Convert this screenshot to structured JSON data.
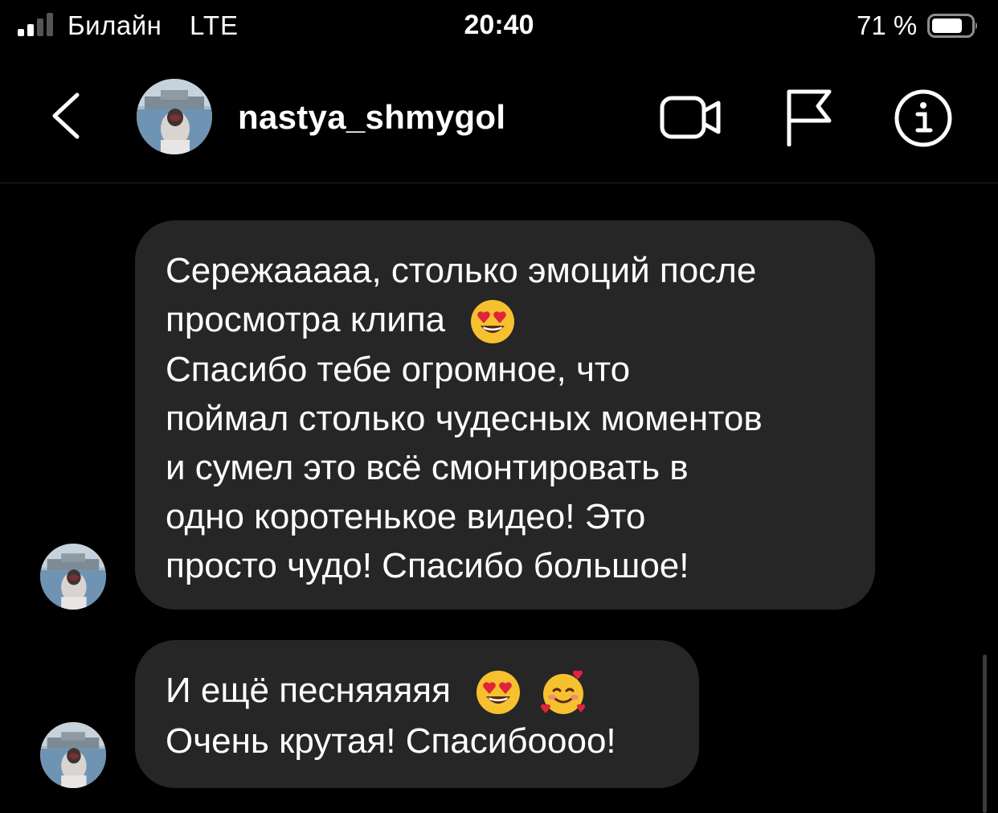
{
  "status_bar": {
    "carrier": "Билайн",
    "network": "LTE",
    "time": "20:40",
    "battery": "71 %"
  },
  "header": {
    "username": "nastya_shmygol",
    "icons": [
      "back-chevron-icon",
      "video-call-icon",
      "flag-icon",
      "info-icon"
    ]
  },
  "messages": [
    {
      "lines": [
        "Сережааааа, столько эмоций после",
        "просмотра клипа",
        "Спасибо тебе огромное, что",
        "поймал столько чудесных моментов",
        "и сумел это всё смонтировать в",
        "одно коротенькое видео! Это",
        "просто чудо! Спасибо большое!"
      ],
      "emoji": [
        "heart-eyes-emoji"
      ]
    },
    {
      "lines": [
        "И ещё песняяяяя",
        "Очень крутая! Спасибоооо!"
      ],
      "emoji": [
        "heart-eyes-emoji",
        "smiling-face-with-hearts-emoji"
      ]
    }
  ],
  "colors": {
    "background": "#000000",
    "bubble": "#262626",
    "text": "#ffffff"
  }
}
